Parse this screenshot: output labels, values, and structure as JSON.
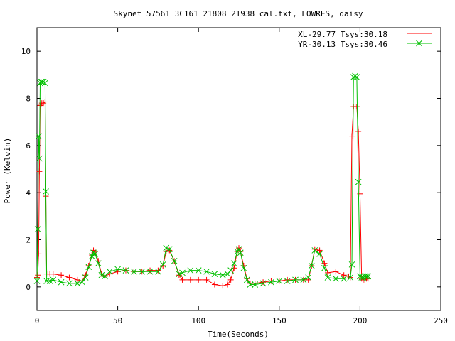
{
  "chart_data": {
    "type": "line",
    "title": "Skynet_57561_3C161_21808_21938_cal.txt, LOWRES, daisy",
    "xlabel": "Time(Seconds)",
    "ylabel": "Power (Kelvin)",
    "xlim": [
      0,
      250
    ],
    "ylim": [
      -1,
      11
    ],
    "xticks": [
      0,
      50,
      100,
      150,
      200,
      250
    ],
    "yticks": [
      0,
      2,
      4,
      6,
      8,
      10
    ],
    "grid": false,
    "legend_position": "top-right",
    "series": [
      {
        "name": "XL-29.77 Tsys:30.18",
        "color": "#ff0000",
        "marker": "plus",
        "x": [
          0,
          0.5,
          1,
          1.5,
          2,
          2.5,
          3,
          4,
          5,
          5.5,
          6,
          8,
          10,
          15,
          20,
          25,
          28,
          30,
          32,
          34,
          35,
          36,
          38,
          40,
          42,
          45,
          50,
          55,
          60,
          65,
          70,
          75,
          78,
          80,
          82,
          85,
          88,
          90,
          95,
          100,
          105,
          110,
          115,
          118,
          120,
          122,
          124,
          125,
          126,
          128,
          130,
          132,
          135,
          140,
          145,
          150,
          155,
          160,
          165,
          168,
          170,
          172,
          175,
          178,
          180,
          185,
          190,
          193,
          194,
          195,
          196,
          197,
          198,
          199,
          200,
          201,
          202,
          203,
          204,
          205
        ],
        "y": [
          0.4,
          0.5,
          1.4,
          4.9,
          7.7,
          7.75,
          7.8,
          7.8,
          7.85,
          3.85,
          0.55,
          0.55,
          0.55,
          0.5,
          0.4,
          0.3,
          0.25,
          0.5,
          0.9,
          1.35,
          1.55,
          1.5,
          1.1,
          0.55,
          0.45,
          0.55,
          0.65,
          0.7,
          0.65,
          0.65,
          0.7,
          0.7,
          0.9,
          1.5,
          1.55,
          1.1,
          0.5,
          0.3,
          0.3,
          0.3,
          0.3,
          0.1,
          0.05,
          0.1,
          0.3,
          0.8,
          1.5,
          1.65,
          1.5,
          0.9,
          0.35,
          0.15,
          0.15,
          0.2,
          0.25,
          0.25,
          0.3,
          0.3,
          0.3,
          0.3,
          0.9,
          1.6,
          1.55,
          1.0,
          0.6,
          0.65,
          0.5,
          0.45,
          0.4,
          6.4,
          7.65,
          7.65,
          7.65,
          6.6,
          3.95,
          0.35,
          0.3,
          0.3,
          0.35,
          0.35
        ]
      },
      {
        "name": "YR-30.13 Tsys:30.46",
        "color": "#00c000",
        "marker": "cross",
        "x": [
          0,
          0.5,
          1,
          1.5,
          2,
          2.5,
          3,
          4,
          5,
          5.5,
          6,
          8,
          10,
          15,
          20,
          25,
          28,
          30,
          32,
          34,
          35,
          36,
          38,
          40,
          42,
          45,
          50,
          55,
          60,
          65,
          70,
          75,
          78,
          80,
          82,
          85,
          88,
          90,
          95,
          100,
          105,
          110,
          115,
          118,
          120,
          122,
          124,
          125,
          126,
          128,
          130,
          132,
          135,
          140,
          145,
          150,
          155,
          160,
          165,
          168,
          170,
          172,
          175,
          178,
          180,
          185,
          190,
          194,
          195,
          196,
          197,
          198,
          199,
          200,
          201,
          202,
          203,
          204,
          205
        ],
        "y": [
          0.25,
          2.45,
          6.4,
          5.45,
          8.65,
          8.7,
          8.7,
          8.7,
          8.65,
          4.05,
          0.25,
          0.25,
          0.3,
          0.2,
          0.15,
          0.15,
          0.2,
          0.4,
          0.85,
          1.3,
          1.45,
          1.4,
          1.0,
          0.5,
          0.45,
          0.65,
          0.75,
          0.7,
          0.65,
          0.65,
          0.65,
          0.65,
          0.95,
          1.65,
          1.6,
          1.1,
          0.55,
          0.6,
          0.7,
          0.7,
          0.65,
          0.55,
          0.5,
          0.55,
          0.7,
          1.0,
          1.5,
          1.6,
          1.45,
          0.8,
          0.3,
          0.1,
          0.1,
          0.15,
          0.2,
          0.25,
          0.25,
          0.3,
          0.3,
          0.4,
          0.9,
          1.55,
          1.4,
          0.8,
          0.4,
          0.35,
          0.35,
          0.4,
          0.95,
          8.9,
          8.95,
          8.9,
          4.45,
          0.45,
          0.4,
          0.4,
          0.45,
          0.45,
          0.45
        ]
      }
    ]
  }
}
